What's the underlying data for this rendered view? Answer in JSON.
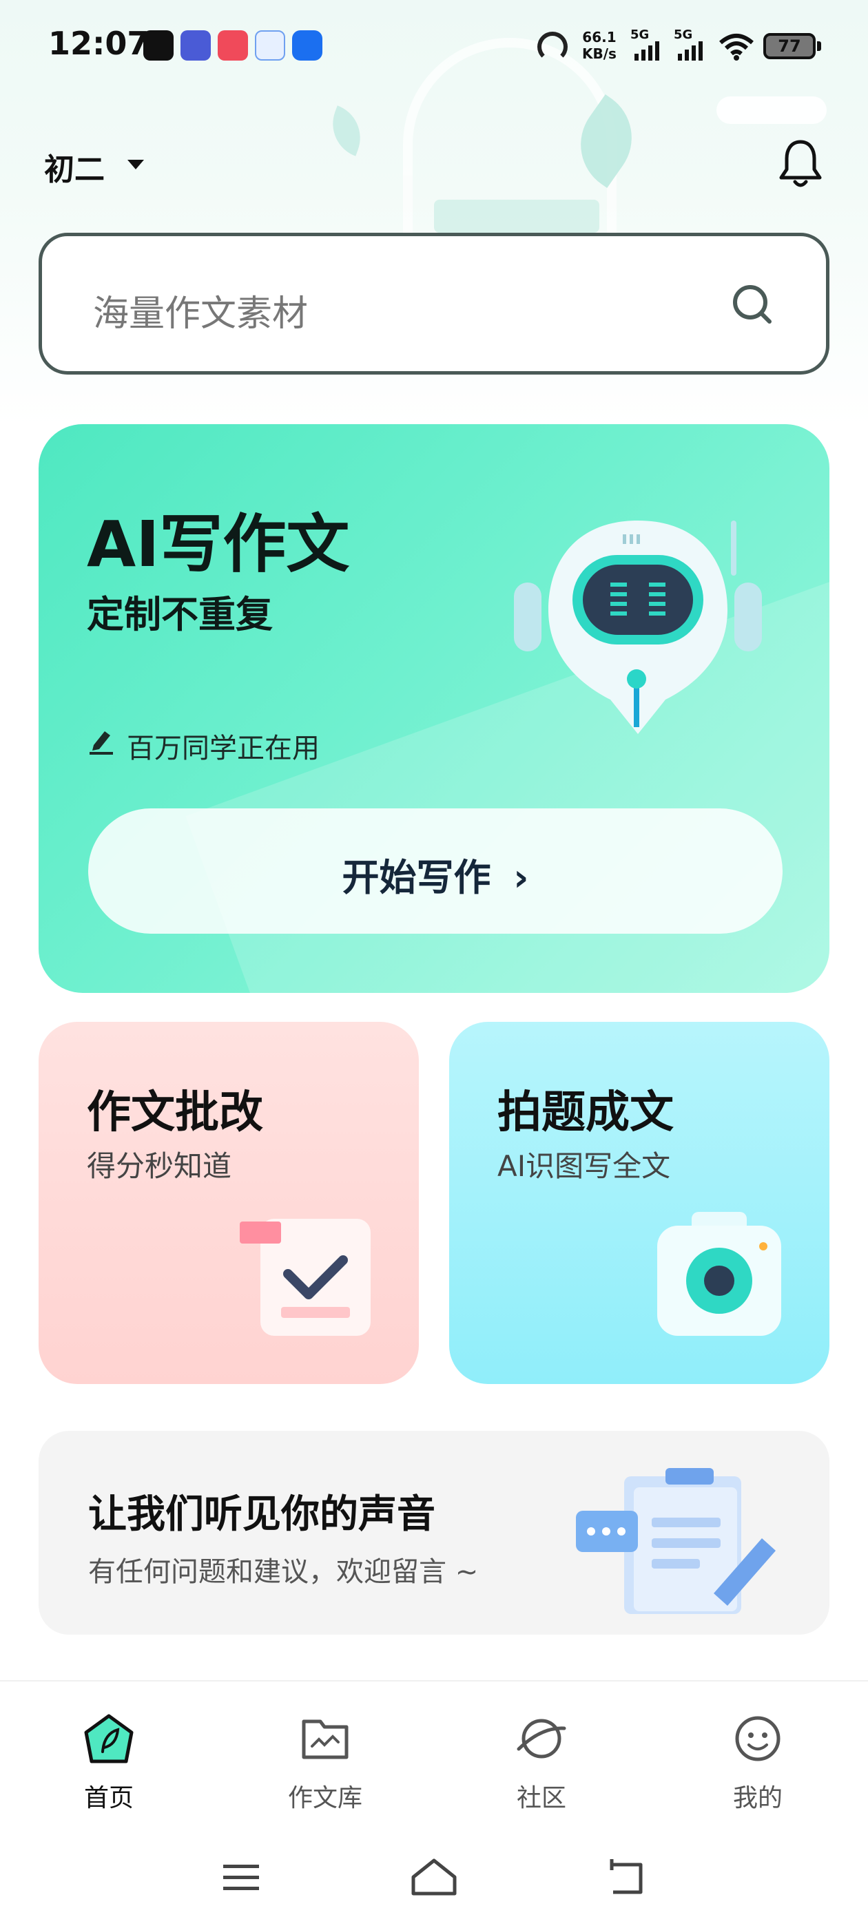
{
  "status_bar": {
    "time": "12:07",
    "speed_value": "66.1",
    "speed_unit": "KB/s",
    "signal1": "5G",
    "signal2": "5G",
    "battery": "77",
    "notification_icons": [
      "tiktok-icon",
      "tieba-icon",
      "jd-618-icon",
      "baidu-netdisk-icon",
      "k-app-icon"
    ]
  },
  "header": {
    "grade": "初二",
    "bell_icon": "bell-icon"
  },
  "search": {
    "placeholder": "海量作文素材"
  },
  "ai_card": {
    "title": "AI写作文",
    "subtitle": "定制不重复",
    "users_text": "百万同学正在用",
    "button_label": "开始写作",
    "accent": "#4fe8c1"
  },
  "feature_cards": [
    {
      "title": "作文批改",
      "subtitle": "得分秒知道",
      "icon": "checklist-icon",
      "color": "#ffd9d7"
    },
    {
      "title": "拍题成文",
      "subtitle": "AI识图写全文",
      "icon": "camera-icon",
      "color": "#a4f1fb"
    }
  ],
  "feedback": {
    "title": "让我们听见你的声音",
    "subtitle": "有任何问题和建议，欢迎留言 ~"
  },
  "tabbar": {
    "items": [
      {
        "label": "首页",
        "icon": "home-leaf-icon",
        "active": true
      },
      {
        "label": "作文库",
        "icon": "folder-icon",
        "active": false
      },
      {
        "label": "社区",
        "icon": "planet-icon",
        "active": false
      },
      {
        "label": "我的",
        "icon": "smiley-icon",
        "active": false
      }
    ]
  },
  "system_nav": {
    "items": [
      "menu-icon",
      "home-icon",
      "back-icon"
    ]
  }
}
